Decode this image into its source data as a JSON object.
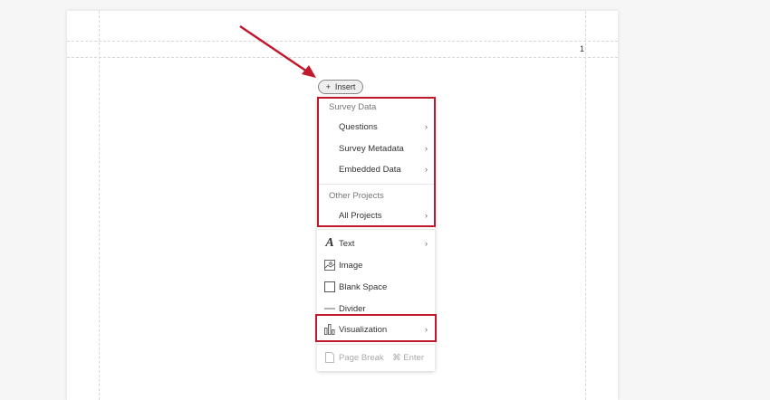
{
  "page": {
    "number": "1"
  },
  "insert_button": {
    "icon": "plus-icon",
    "label": "Insert"
  },
  "menu": {
    "survey_data_header": "Survey Data",
    "survey_items": [
      {
        "label": "Questions"
      },
      {
        "label": "Survey Metadata"
      },
      {
        "label": "Embedded Data"
      }
    ],
    "other_projects_header": "Other Projects",
    "project_items": [
      {
        "label": "All Projects"
      }
    ],
    "content_items": [
      {
        "label": "Text",
        "icon": "text-icon"
      },
      {
        "label": "Image",
        "icon": "image-icon"
      },
      {
        "label": "Blank Space",
        "icon": "blank-space-icon"
      },
      {
        "label": "Divider",
        "icon": "divider-icon"
      },
      {
        "label": "Visualization",
        "icon": "visualization-icon"
      }
    ],
    "page_break": {
      "label": "Page Break",
      "shortcut": "⌘ Enter"
    }
  },
  "colors": {
    "highlight": "#c0182d"
  }
}
